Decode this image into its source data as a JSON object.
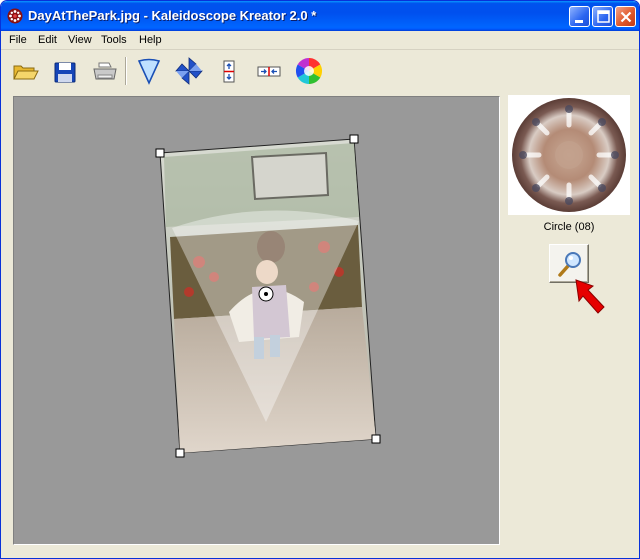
{
  "window": {
    "title": "DayAtThePark.jpg - Kaleidoscope Kreator  2.0 *",
    "title_icon": "kaleidoscope-app-icon",
    "controls": [
      "minimize-icon",
      "maximize-icon",
      "close-icon"
    ]
  },
  "menu": {
    "items": [
      {
        "label": "File"
      },
      {
        "label": "Edit"
      },
      {
        "label": "View"
      },
      {
        "label": "Tools"
      },
      {
        "label": "Help"
      }
    ]
  },
  "toolbar": {
    "tools": [
      "open-folder-icon",
      "save-disk-icon",
      "print-icon",
      "wedge-icon",
      "pinwheel-icon",
      "mirror-vertical-icon",
      "mirror-horizontal-icon",
      "color-wheel-icon"
    ]
  },
  "preview": {
    "label": "Circle (08)",
    "zoom_icon": "magnifier-icon"
  },
  "colors": {
    "canvas_bg": "#999999",
    "window_bg": "#ece9d8",
    "titlebar": "#0054e3",
    "arrow": "#e60000"
  }
}
